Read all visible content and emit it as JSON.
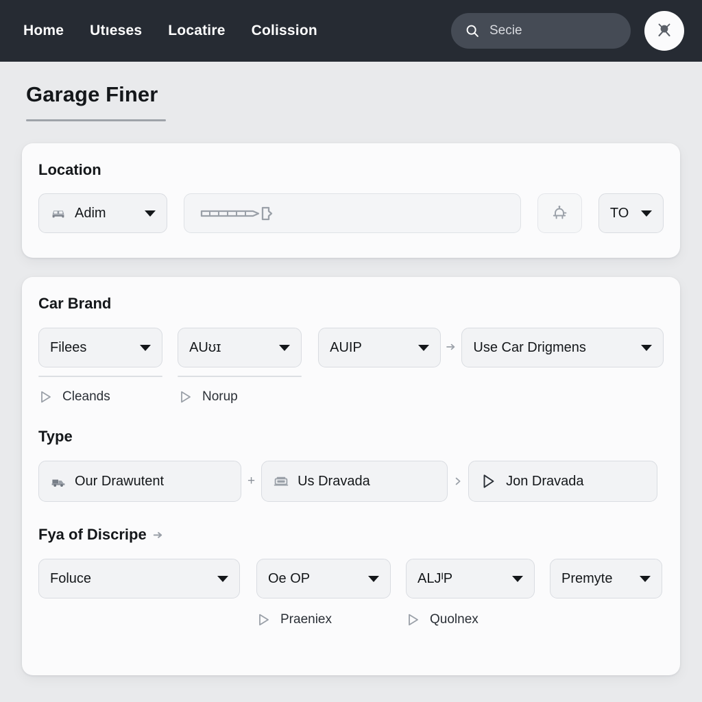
{
  "topnav": {
    "links": [
      {
        "label": "Home"
      },
      {
        "label": "Utıeses"
      },
      {
        "label": "Locatire"
      },
      {
        "label": "Colission"
      }
    ],
    "search": {
      "value": "Secie",
      "icon": "search-icon"
    },
    "avatar": {
      "icon": "avatar-glyph-icon"
    },
    "background_color": "#262b33"
  },
  "page": {
    "title": "Garage Finer",
    "background_color": "#e9eaec",
    "card_color": "#fbfbfc"
  },
  "location_card": {
    "heading": "Location",
    "brand_select": {
      "label": "Adim",
      "icon": "car-icon"
    },
    "address_field": {
      "glyph": "ruler-arrow-icon"
    },
    "icon_button": {
      "icon": "bell-robot-icon"
    },
    "to_select": {
      "label": "TO"
    }
  },
  "filters_card": {
    "car_brand": {
      "heading": "Car Brand",
      "selects": [
        {
          "label": "Filees",
          "underline": true
        },
        {
          "label": "AUʊɪ",
          "underline": true
        },
        {
          "label": "AUIP",
          "underline": false
        },
        {
          "label": "Use   Car Drigmens",
          "underline": false
        }
      ],
      "separator_icon": "arrow-right-icon",
      "subitems": [
        {
          "label": "Cleands",
          "icon": "play-outline-icon"
        },
        {
          "label": "Norup",
          "icon": "play-outline-icon"
        }
      ]
    },
    "type": {
      "heading": "Type",
      "options": [
        {
          "label": "Our Drawutent",
          "icon": "truck-icon"
        },
        {
          "label": "Us Dravada",
          "icon": "car-front-icon"
        },
        {
          "label": "Jon Dravada",
          "icon": "play-outline-icon"
        }
      ],
      "separator_plus": "+",
      "separator_arrow_icon": "arrow-right-icon"
    },
    "discripe": {
      "heading": "Fya of Discripe",
      "heading_icon": "arrow-right-icon",
      "selects": [
        {
          "label": "Foluce"
        },
        {
          "label": "Oe OP"
        },
        {
          "label": "ALJᴵP"
        },
        {
          "label": "Premyte"
        }
      ],
      "subitems": [
        {
          "label": "Praeniex",
          "icon": "play-outline-icon"
        },
        {
          "label": "Quolnex",
          "icon": "play-outline-icon"
        }
      ]
    }
  }
}
